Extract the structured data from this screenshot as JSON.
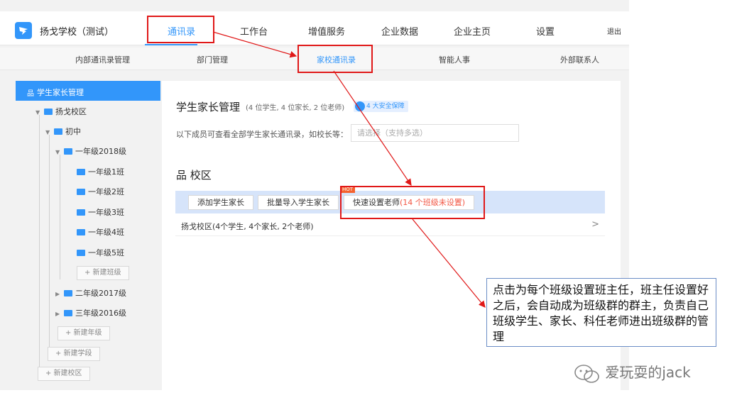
{
  "header": {
    "brand": "扬戈学校（测试）",
    "nav": [
      "通讯录",
      "工作台",
      "增值服务",
      "企业数据",
      "企业主页",
      "设置"
    ],
    "logout": "退出",
    "accent": "#3296fa"
  },
  "subnav": [
    "内部通讯录管理",
    "部门管理",
    "家校通讯录",
    "智能人事",
    "外部联系人"
  ],
  "sidebar": {
    "header": "学生家长管理",
    "campus": "扬戈校区",
    "stage": "初中",
    "grade_open": "一年级2018级",
    "classes": [
      "一年级1班",
      "一年级2班",
      "一年级3班",
      "一年级4班",
      "一年级5班"
    ],
    "add_class": "+ 新建班级",
    "grades_closed": [
      "二年级2017级",
      "三年级2016级"
    ],
    "add_grade": "+ 新建年级",
    "add_stage": "+ 新建学段",
    "add_campus": "+ 新建校区"
  },
  "main": {
    "title": "学生家长管理",
    "stats": "(4 位学生, 4 位家长, 2 位老师)",
    "safety_badge": "4 大安全保障",
    "desc": "以下成员可查看全部学生家长通讯录，如校长等：",
    "picker_placeholder": "请选择（支持多选）",
    "section_title": "校区",
    "buttons": {
      "add_parent": "添加学生家长",
      "batch_import": "批量导入学生家长",
      "quick_teacher": "快速设置老师",
      "quick_teacher_warn": "(14 个班级未设置)",
      "hot": "HOT"
    },
    "school_row": "扬戈校区(4个学生, 4个家长, 2个老师)"
  },
  "annotation": {
    "callout": "点击为每个班级设置班主任，班主任设置好之后，会自动成为班级群的群主，负责自己班级学生、家长、科任老师进出班级群的管理",
    "watermark": "爱玩耍的jack"
  }
}
